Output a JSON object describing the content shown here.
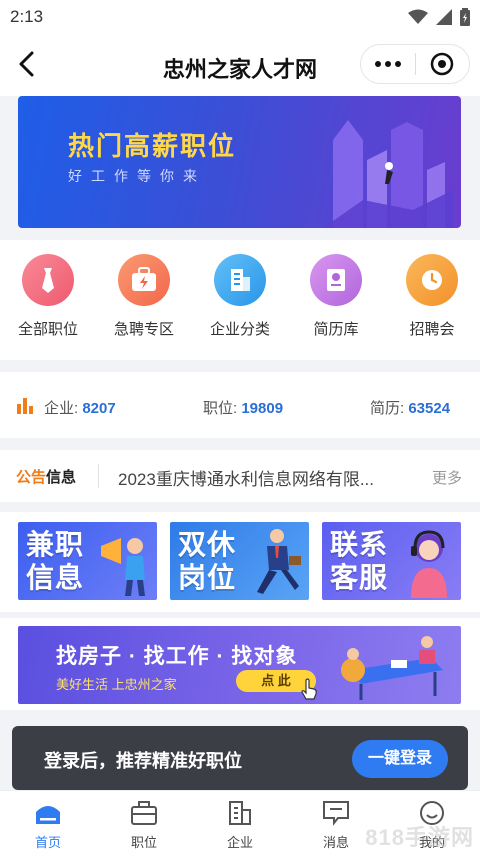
{
  "status": {
    "time": "2:13"
  },
  "navbar": {
    "title": "忠州之家人才网"
  },
  "banner": {
    "title": "热门高薪职位",
    "subtitle": "好工作等你来"
  },
  "quick_menu": [
    {
      "label": "全部职位",
      "icon": "necktie-icon",
      "color": "#f26a7b"
    },
    {
      "label": "急聘专区",
      "icon": "briefcase-lightning-icon",
      "color": "#f77b57"
    },
    {
      "label": "企业分类",
      "icon": "building-icon",
      "color": "#3fa8ef"
    },
    {
      "label": "简历库",
      "icon": "resume-icon",
      "color": "#c57be6"
    },
    {
      "label": "招聘会",
      "icon": "clock-icon",
      "color": "#f7a23a"
    }
  ],
  "stats": {
    "company_label": "企业:",
    "company_value": "8207",
    "job_label": "职位:",
    "job_value": "19809",
    "resume_label": "简历:",
    "resume_value": "63524"
  },
  "notice": {
    "tag_a": "公告",
    "tag_b": "信息",
    "text": "2023重庆博通水利信息网络有限...",
    "more": "更多"
  },
  "tiles": [
    {
      "line1": "兼职",
      "line2": "信息"
    },
    {
      "line1": "双休",
      "line2": "岗位"
    },
    {
      "line1": "联系",
      "line2": "客服"
    }
  ],
  "promo": {
    "title": "找房子 · 找工作 · 找对象",
    "subtitle": "美好生活  上忠州之家",
    "button": "点 此"
  },
  "login_bar": {
    "text": "登录后，推荐精准好职位",
    "button": "一键登录"
  },
  "tabbar": [
    {
      "label": "首页",
      "icon": "home-icon",
      "active": true
    },
    {
      "label": "职位",
      "icon": "briefcase-icon",
      "active": false
    },
    {
      "label": "企业",
      "icon": "company-icon",
      "active": false
    },
    {
      "label": "消息",
      "icon": "message-icon",
      "active": false
    },
    {
      "label": "我的",
      "icon": "profile-icon",
      "active": false
    }
  ],
  "watermark": "818手游网",
  "colors": {
    "accent": "#2f7bf2",
    "stat_value": "#2a6fd6",
    "banner_title": "#ffd84a"
  }
}
